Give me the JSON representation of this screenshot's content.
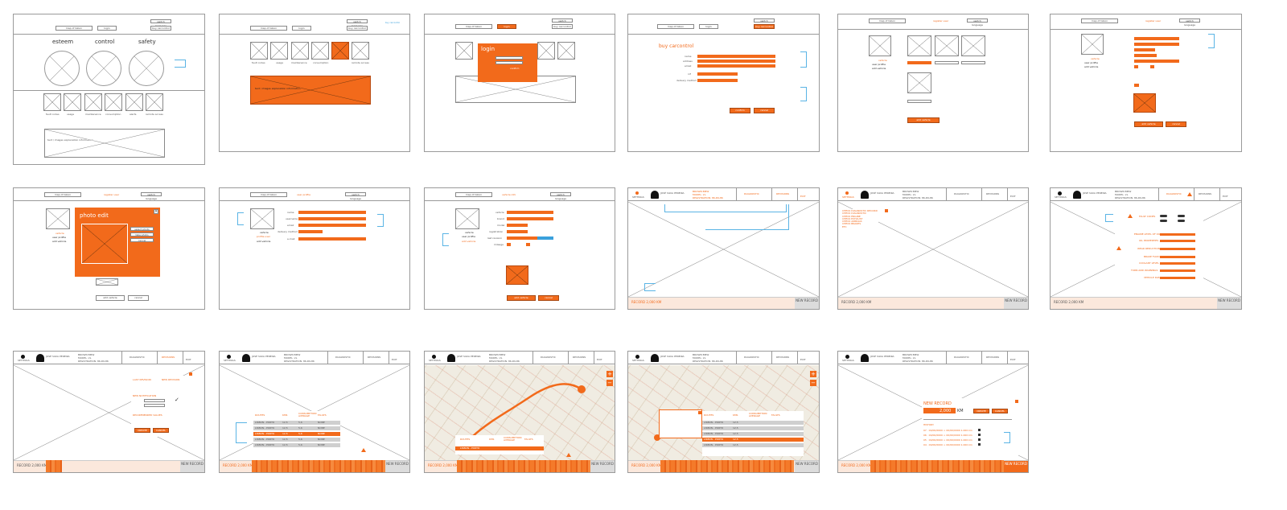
{
  "common": {
    "map_label": "map of lisbon",
    "login": "login",
    "switch_language": "switch language",
    "buy_carcontrol": "buy carcontrol",
    "vehicle": "vehicle",
    "user_profile": "user profile",
    "add_vehicle": "add vehicle",
    "cancel": "cancel",
    "confirm": "confirm",
    "create": "CREATE",
    "cancel_caps": "CANCEL",
    "settings": "SETTINGS",
    "user_name": "JOSÉ SILVA PEREIRA",
    "car_name": "BROWN BMW",
    "car_model": "MODEL: 2L",
    "car_reg": "REGISTRATION: 86-DK-86",
    "diagnostic": "DIAGNOSTIC",
    "revisions": "REVISIONS",
    "exit": "EXIT",
    "record_label": "RECORD 2,000 KM",
    "new_record": "NEW RECORD"
  },
  "screen1": {
    "words": [
      "esteem",
      "control",
      "safety"
    ],
    "icon_labels": [
      "fault codes",
      "usage",
      "maintenance",
      "consumption",
      "alerts",
      "remote access"
    ]
  },
  "screen2": {
    "icon_labels": [
      "fault codes",
      "usage",
      "maintenance",
      "consumption",
      "remote access"
    ],
    "info": "text / images explanation information"
  },
  "screen3": {
    "title": "login",
    "confirm": "confirm"
  },
  "screen4": {
    "title": "buy carcontrol",
    "fields": [
      "name",
      "address",
      "email",
      "nif",
      "delivery method"
    ]
  },
  "screen6": {
    "title": "register user"
  },
  "screen7": {
    "title": "photo edit",
    "menu": [
      "select photo",
      "take photo",
      "cancel"
    ]
  },
  "screen8": {
    "title": "user profile",
    "fields": [
      "name",
      "username",
      "email",
      "delivery method",
      "e-mail"
    ],
    "link": "profile user"
  },
  "screen9": {
    "title": "vehicle info",
    "fields": [
      "vehicle",
      "brand",
      "model",
      "registration",
      "last revision",
      "mileage"
    ]
  },
  "screen11": {
    "links": [
      "CHECK DIAGNOSTIC RECORD",
      "CHECK DIAGNOSTIC",
      "CHECK ENGINE",
      "CHECK EXHAUST",
      "CHECK AIRBAGS",
      "CHECK BRAKES",
      "ETC"
    ]
  },
  "screen12": {
    "items": [
      "FAULT CODES",
      "ENGINE LEVEL OF OIL",
      "OIL PROPERTIES",
      "WEAR REDUCTION",
      "BRAKE FLUID",
      "COOLANT LEVEL",
      "TURN AND WARNINGS",
      "VEHICLE DATA"
    ]
  },
  "screen13": {
    "last_revision": "LAST REVISION",
    "new_revision": "NEW REVISION",
    "new_notification": "NEW NOTIFICATION",
    "recommended": "RECOMMENDED VALUES"
  },
  "table": {
    "headers": [
      "ROUTES",
      "KMS",
      "CONSUMPTION AVERAGE",
      "FAULTS"
    ],
    "rows": [
      [
        "LISBON - PORTO",
        "12,5",
        "5,6",
        "NONE"
      ],
      [
        "LISBON - PORTO",
        "12,5",
        "5,6",
        "NONE"
      ],
      [
        "LISBON - PORTO",
        "12,5",
        "5,6",
        "NONE"
      ],
      [
        "LISBON - PORTO",
        "12,5",
        "5,6",
        "NONE"
      ],
      [
        "LISBON - PORTO",
        "12,5",
        "5,6",
        "NONE"
      ]
    ]
  },
  "screen17": {
    "title": "NEW RECORD",
    "km_value": "2,000",
    "km_unit": "KM",
    "history": "HISTORY",
    "history_rows": [
      "07 · 00/00/0000 > 00/00/0000 1.000 km",
      "06 · 00/00/0000 > 00/00/0000 1.000 km",
      "05 · 00/00/0000 > 00/00/0000 1.000 km",
      "04 · 00/00/0000 > 00/00/0000 1.000 km"
    ]
  },
  "colors": {
    "accent": "#f26a1b",
    "annotation": "#3aa0dc",
    "wire": "#888888"
  }
}
